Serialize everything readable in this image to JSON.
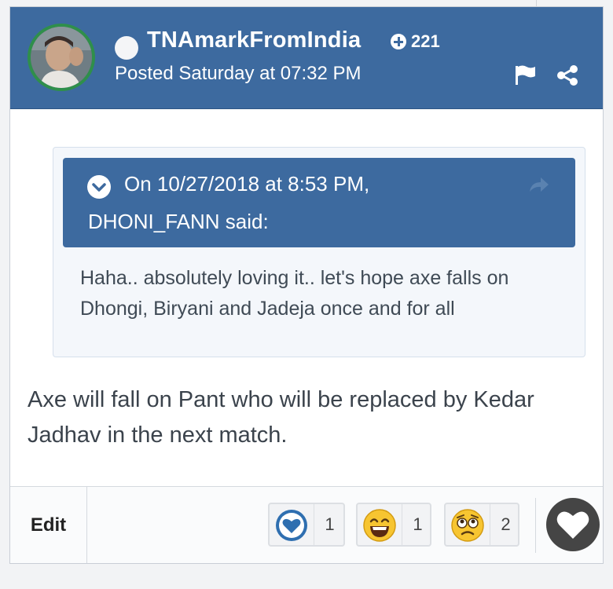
{
  "post": {
    "author": "TNAmarkFromIndia",
    "reputation": "221",
    "posted": "Posted Saturday at 07:32 PM",
    "body": "Axe will fall on Pant who will be replaced by Kedar Jadhav in the next match."
  },
  "quote": {
    "date_line": "On 10/27/2018 at 8:53 PM,",
    "said_line": "DHONI_FANN said:",
    "text": "Haha.. absolutely loving it.. let's hope axe falls on Dhongi, Biryani and Jadeja once and for all"
  },
  "footer": {
    "edit_label": "Edit",
    "reactions": [
      {
        "icon": "heart-icon",
        "count": "1"
      },
      {
        "icon": "laugh-emoji-icon",
        "count": "1"
      },
      {
        "icon": "sad-emoji-icon",
        "count": "2"
      }
    ]
  },
  "colors": {
    "header_bg": "#3d6a9f",
    "avatar_ring": "#2f8f4b",
    "like_button": "#454545"
  }
}
